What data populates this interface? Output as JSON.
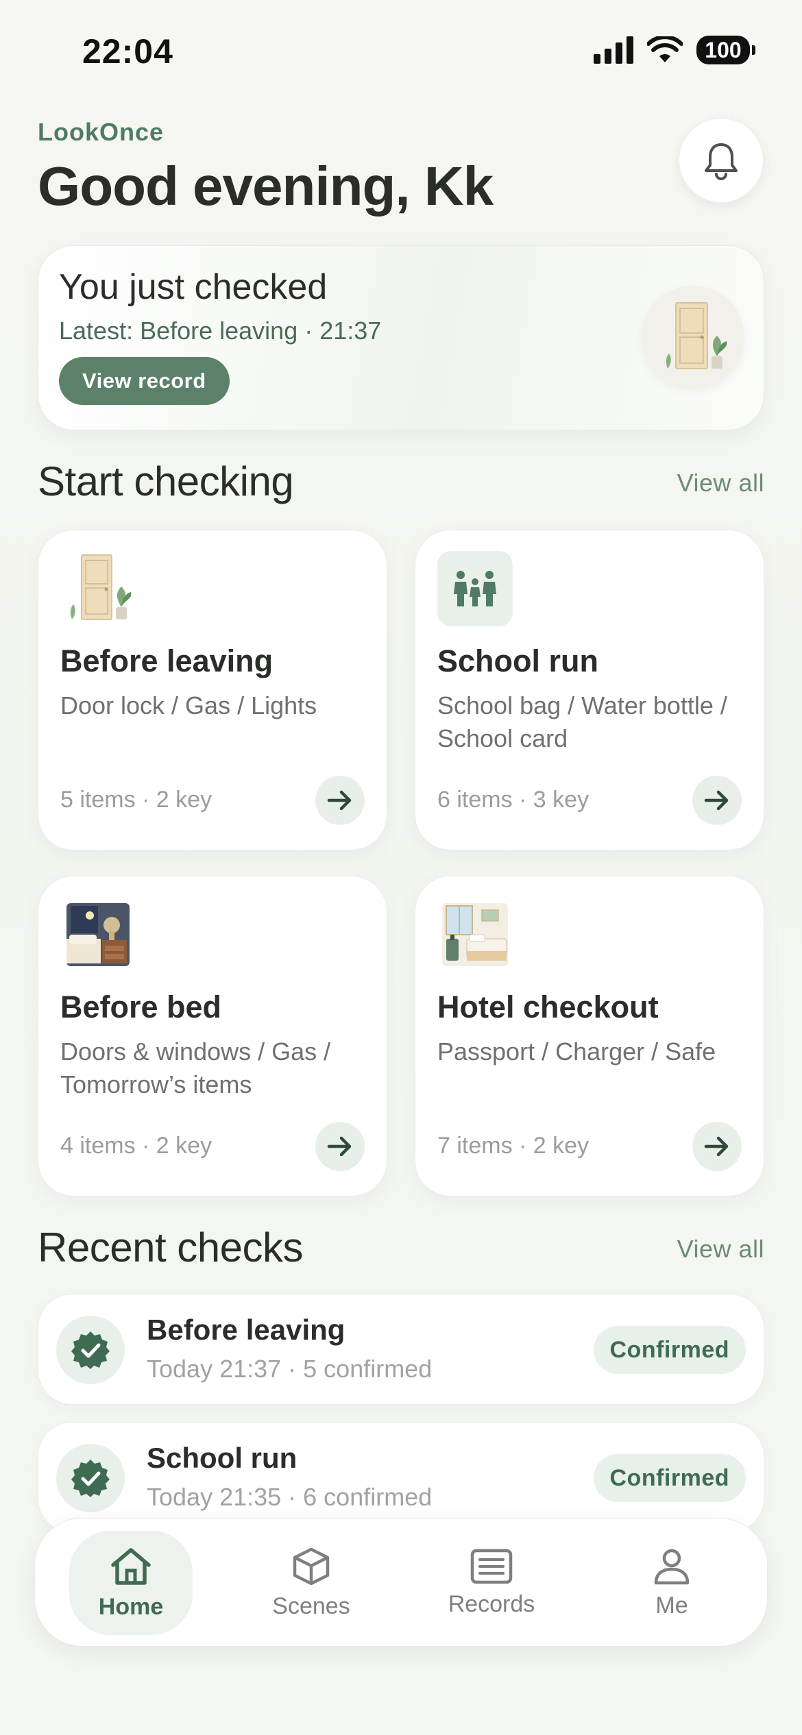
{
  "status_bar": {
    "time": "22:04",
    "battery": "100"
  },
  "header": {
    "brand": "LookOnce",
    "greeting": "Good evening, Kk"
  },
  "last_check": {
    "title": "You just checked",
    "subtitle": "Latest: Before leaving · 21:37",
    "button_label": "View record"
  },
  "start_section": {
    "title": "Start checking",
    "view_all": "View all"
  },
  "scenes": [
    {
      "name": "Before leaving",
      "description": "Door lock / Gas / Lights",
      "meta": "5 items · 2 key",
      "icon": "door-plant-icon"
    },
    {
      "name": "School run",
      "description": "School bag / Water bottle / School card",
      "meta": "6 items · 3 key",
      "icon": "family-icon"
    },
    {
      "name": "Before bed",
      "description": "Doors & windows / Gas / Tomorrow’s items",
      "meta": "4 items · 2 key",
      "icon": "bedroom-icon"
    },
    {
      "name": "Hotel checkout",
      "description": "Passport / Charger / Safe",
      "meta": "7 items · 2 key",
      "icon": "hotel-room-icon"
    }
  ],
  "recent_section": {
    "title": "Recent checks",
    "view_all": "View all"
  },
  "recent": [
    {
      "title": "Before leaving",
      "subtitle": "Today 21:37  ·  5 confirmed",
      "status": "Confirmed"
    },
    {
      "title": "School run",
      "subtitle": "Today 21:35  ·  6 confirmed",
      "status": "Confirmed"
    }
  ],
  "tabs": [
    {
      "label": "Home",
      "icon": "home-icon",
      "active": true
    },
    {
      "label": "Scenes",
      "icon": "cube-icon",
      "active": false
    },
    {
      "label": "Records",
      "icon": "records-icon",
      "active": false
    },
    {
      "label": "Me",
      "icon": "person-icon",
      "active": false
    }
  ],
  "colors": {
    "accent": "#5b8169",
    "accent_dark": "#3f6b53",
    "brand_text": "#4f7a63",
    "soft_green": "#e8f0ea"
  }
}
